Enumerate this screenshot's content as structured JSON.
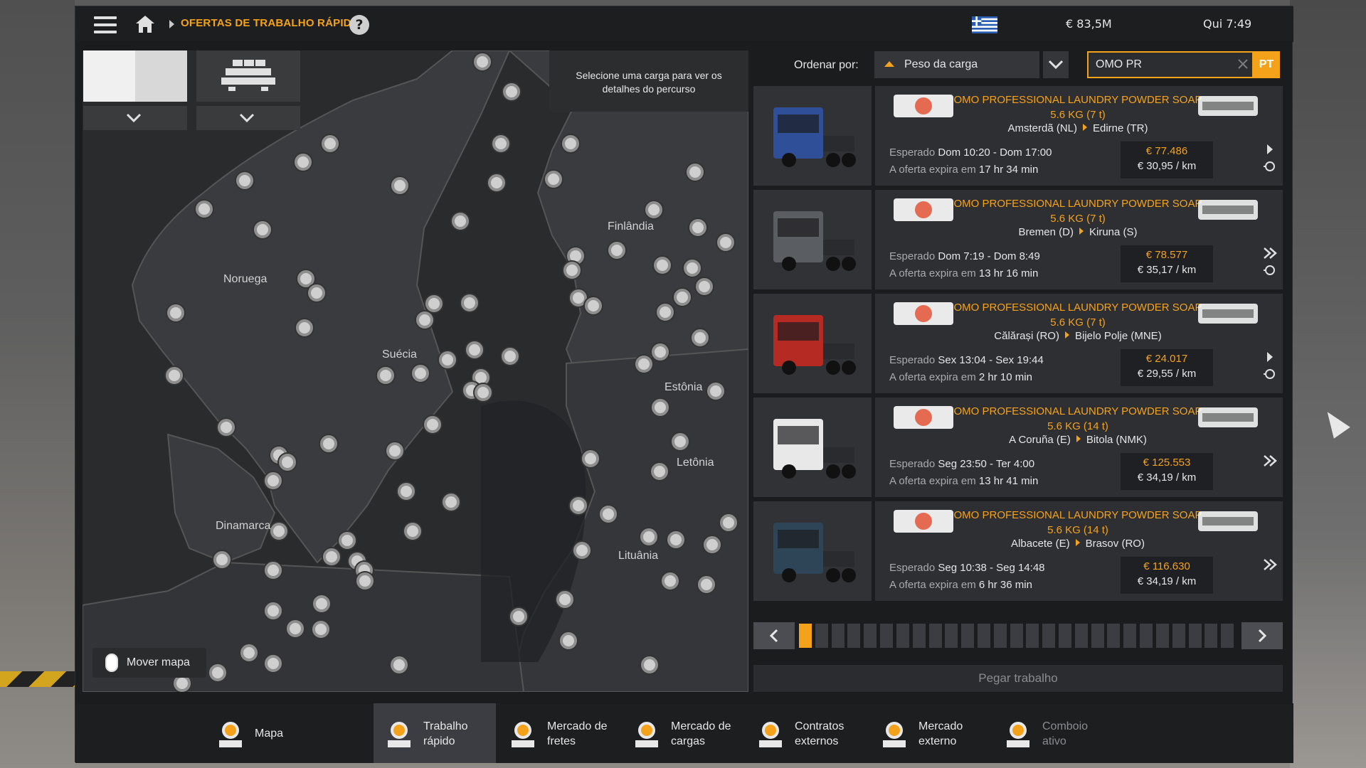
{
  "header": {
    "breadcrumb_title": "OFERTAS DE TRABALHO RÁPIDO",
    "help": "?",
    "money": "€ 83,5M",
    "clock": "Qui 7:49"
  },
  "map": {
    "tooltip": "Selecione uma carga para ver os detalhes do percurso",
    "labels": {
      "noruega": "Noruega",
      "suecia": "Suécia",
      "finlandia": "Finlândia",
      "estonia": "Estônia",
      "letonia": "Letônia",
      "dinamarca": "Dinamarca",
      "lituania": "Lituânia"
    },
    "move_map": "Mover mapa"
  },
  "sort": {
    "label": "Ordenar por:",
    "selected": "Peso da carga"
  },
  "search": {
    "value": "OMO PR",
    "lang": "PT"
  },
  "jobs": [
    {
      "cargo": "OMO PROFESSIONAL LAUNDRY POWDER SOAP 5.6 KG (7 t)",
      "from": "Amsterdã (NL)",
      "to": "Edirne (TR)",
      "expected_prefix": "Esperado",
      "expected": "Dom 10:20 - Dom 17:00",
      "expires_prefix": "A oferta expira em",
      "expires": "17 hr 34 min",
      "price": "€ 77.486",
      "per_km": "€ 30,95 / km",
      "logo_left": "NSOil",
      "logo_right": "Balkan Loco",
      "truck_color": "#2f4f99"
    },
    {
      "cargo": "OMO PROFESSIONAL LAUNDRY POWDER SOAP 5.6 KG (7 t)",
      "from": "Bremen (D)",
      "to": "Kiruna (S)",
      "expected_prefix": "Esperado",
      "expected": "Dom 7:19 - Dom 8:49",
      "expires_prefix": "A oferta expira em",
      "expires": "13 hr 16 min",
      "price": "€ 78.577",
      "per_km": "€ 35,17 / km",
      "logo_left": "Shuttle",
      "logo_right": "RENOR",
      "truck_color": "#5a5d62"
    },
    {
      "cargo": "OMO PROFESSIONAL LAUNDRY POWDER SOAP 5.6 KG (7 t)",
      "from": "Călărași (RO)",
      "to": "Bijelo Polje (MNE)",
      "expected_prefix": "Esperado",
      "expected": "Sex 13:04 - Sex 19:44",
      "expires_prefix": "A oferta expira em",
      "expires": "2 hr 10 min",
      "price": "€ 24.017",
      "per_km": "€ 29,55 / km",
      "logo_left": "globe",
      "logo_right": "CRNO DRVO",
      "truck_color": "#b52a22"
    },
    {
      "cargo": "OMO PROFESSIONAL LAUNDRY POWDER SOAP 5.6 KG (14 t)",
      "from": "A Coruña (E)",
      "to": "Bitola (NMK)",
      "expected_prefix": "Esperado",
      "expected": "Seg 23:50 - Ter 4:00",
      "expires_prefix": "A oferta expira em",
      "expires": "13 hr 41 min",
      "price": "€ 125.553",
      "per_km": "€ 34,19 / km",
      "logo_left": "CNP",
      "logo_right": "SUBSE",
      "truck_color": "#e8e8e8"
    },
    {
      "cargo": "OMO PROFESSIONAL LAUNDRY POWDER SOAP 5.6 KG (14 t)",
      "from": "Albacete (E)",
      "to": "Brasov (RO)",
      "expected_prefix": "Esperado",
      "expected": "Seg 10:38 - Seg 14:48",
      "expires_prefix": "A oferta expira em",
      "expires": "6 hr 36 min",
      "price": "€ 116.630",
      "per_km": "€ 34,19 / km",
      "logo_left": "emblem",
      "logo_right": "Timber Turtle",
      "truck_color": "#2e4557"
    }
  ],
  "pager": {
    "segments": 27,
    "active": 0
  },
  "take_job": "Pegar trabalho",
  "nav": [
    {
      "label": "Mapa",
      "icon": "map-pin-icon"
    },
    {
      "label": "Trabalho\nrápido",
      "icon": "quick-job-clock-icon"
    },
    {
      "label": "Mercado de\nfretes",
      "icon": "freight-market-icon"
    },
    {
      "label": "Mercado de\ncargas",
      "icon": "cargo-market-icon"
    },
    {
      "label": "Contratos\nexternos",
      "icon": "external-contracts-globe-icon"
    },
    {
      "label": "Mercado\nexterno",
      "icon": "external-market-globe-icon"
    },
    {
      "label": "Comboio\nativo",
      "icon": "convoy-icon"
    }
  ],
  "colors": {
    "accent": "#f5a21b",
    "panel": "#2d2f33",
    "bg": "#1b1c1e"
  }
}
